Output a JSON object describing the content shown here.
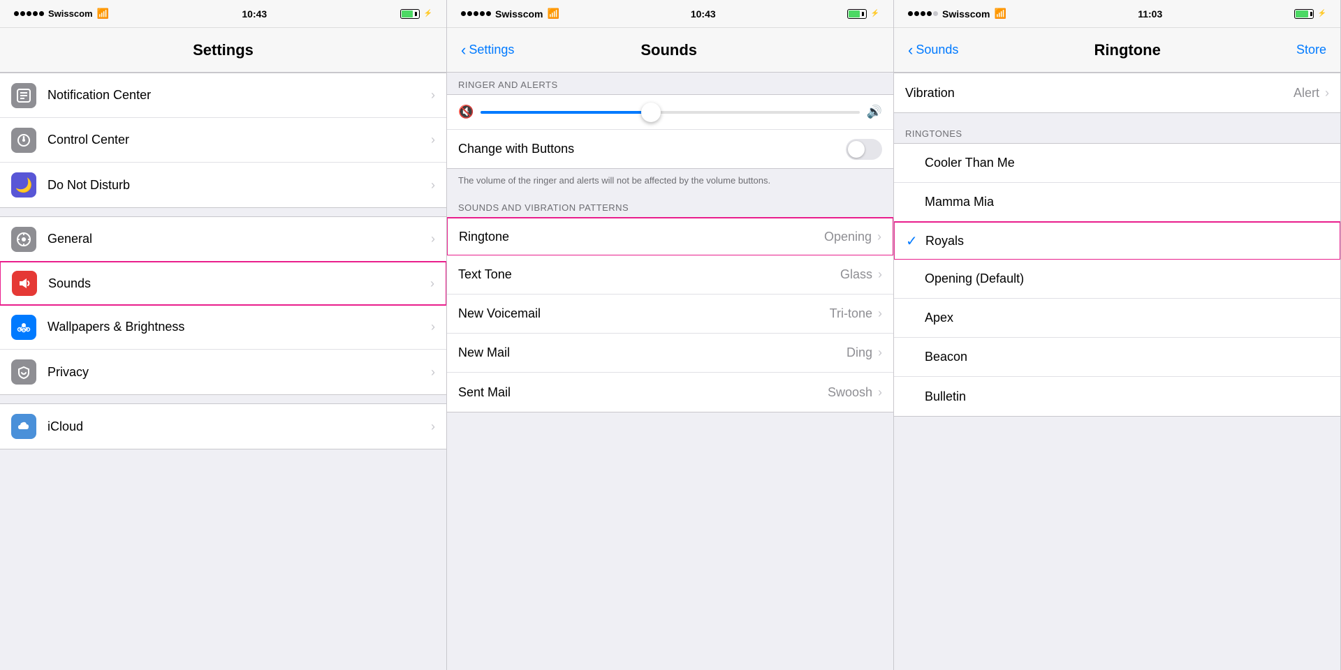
{
  "panel1": {
    "statusBar": {
      "carrier": "Swisscom",
      "time": "10:43",
      "batteryFill": "70%"
    },
    "navTitle": "Settings",
    "sections": [
      {
        "items": [
          {
            "id": "notification-center",
            "label": "Notification Center",
            "iconBg": "icon-gray",
            "iconSymbol": "⊞"
          },
          {
            "id": "control-center",
            "label": "Control Center",
            "iconBg": "icon-gray2",
            "iconSymbol": "⊟"
          },
          {
            "id": "do-not-disturb",
            "label": "Do Not Disturb",
            "iconBg": "icon-purple",
            "iconSymbol": "🌙"
          }
        ]
      },
      {
        "items": [
          {
            "id": "general",
            "label": "General",
            "iconBg": "icon-gray",
            "iconSymbol": "⚙"
          },
          {
            "id": "sounds",
            "label": "Sounds",
            "iconBg": "icon-red",
            "iconSymbol": "🔊",
            "highlighted": true
          },
          {
            "id": "wallpapers",
            "label": "Wallpapers & Brightness",
            "iconBg": "icon-blue",
            "iconSymbol": "✿"
          },
          {
            "id": "privacy",
            "label": "Privacy",
            "iconBg": "icon-gray",
            "iconSymbol": "✋"
          }
        ]
      },
      {
        "items": [
          {
            "id": "icloud",
            "label": "iCloud",
            "iconBg": "icon-icloud",
            "iconSymbol": "☁"
          }
        ]
      }
    ]
  },
  "panel2": {
    "statusBar": {
      "carrier": "Swisscom",
      "time": "10:43",
      "batteryFill": "70%"
    },
    "navBack": "Settings",
    "navTitle": "Sounds",
    "ringerSection": {
      "header": "RINGER AND ALERTS",
      "sliderFillPercent": 45,
      "toggleLabel": "Change with Buttons",
      "toggleOn": false,
      "infoText": "The volume of the ringer and alerts will not be affected by the volume buttons."
    },
    "patternsSection": {
      "header": "SOUNDS AND VIBRATION PATTERNS",
      "items": [
        {
          "id": "ringtone",
          "label": "Ringtone",
          "value": "Opening",
          "highlighted": true
        },
        {
          "id": "text-tone",
          "label": "Text Tone",
          "value": "Glass"
        },
        {
          "id": "new-voicemail",
          "label": "New Voicemail",
          "value": "Tri-tone"
        },
        {
          "id": "new-mail",
          "label": "New Mail",
          "value": "Ding"
        },
        {
          "id": "sent-mail",
          "label": "Sent Mail",
          "value": "Swoosh"
        }
      ]
    }
  },
  "panel3": {
    "statusBar": {
      "carrier": "Swisscom",
      "time": "11:03",
      "batteryFill": "80%"
    },
    "navBack": "Sounds",
    "navTitle": "Ringtone",
    "navAction": "Store",
    "vibrationRow": {
      "label": "Vibration",
      "value": "Alert"
    },
    "ringtonesHeader": "RINGTONES",
    "ringtones": [
      {
        "id": "cooler-than-me",
        "label": "Cooler Than Me",
        "selected": false
      },
      {
        "id": "mamma-mia",
        "label": "Mamma Mia",
        "selected": false
      },
      {
        "id": "royals",
        "label": "Royals",
        "selected": true,
        "highlighted": true
      },
      {
        "id": "opening-default",
        "label": "Opening (Default)",
        "selected": false
      },
      {
        "id": "apex",
        "label": "Apex",
        "selected": false
      },
      {
        "id": "beacon",
        "label": "Beacon",
        "selected": false
      },
      {
        "id": "bulletin",
        "label": "Bulletin",
        "selected": false
      }
    ]
  }
}
